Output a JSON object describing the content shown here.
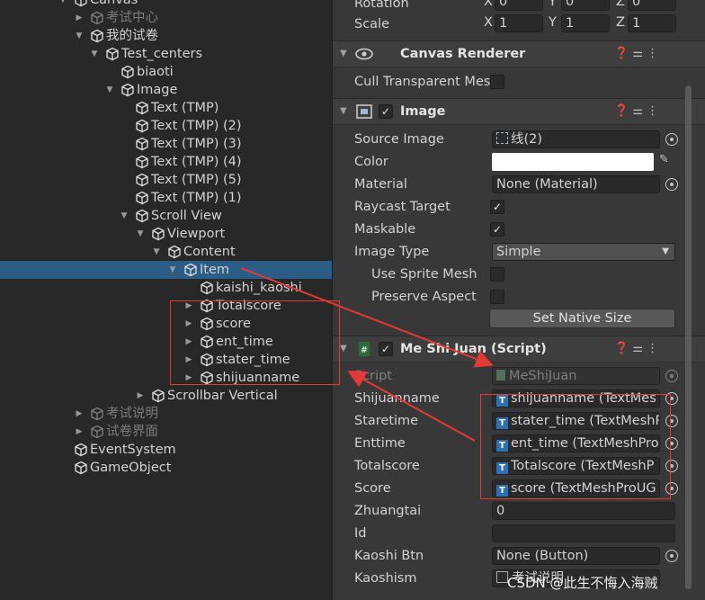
{
  "hierarchy": {
    "rows": [
      {
        "label": "Canvas",
        "dim": false,
        "sel": false
      },
      {
        "label": "考试中心",
        "dim": true,
        "sel": false
      },
      {
        "label": "我的试卷",
        "dim": false,
        "sel": false
      },
      {
        "label": "Test_centers",
        "dim": false,
        "sel": false
      },
      {
        "label": "biaoti",
        "dim": false,
        "sel": false
      },
      {
        "label": "Image",
        "dim": false,
        "sel": false
      },
      {
        "label": "Text (TMP)",
        "dim": false,
        "sel": false
      },
      {
        "label": "Text (TMP) (2)",
        "dim": false,
        "sel": false
      },
      {
        "label": "Text (TMP) (3)",
        "dim": false,
        "sel": false
      },
      {
        "label": "Text (TMP) (4)",
        "dim": false,
        "sel": false
      },
      {
        "label": "Text (TMP) (5)",
        "dim": false,
        "sel": false
      },
      {
        "label": "Text (TMP) (1)",
        "dim": false,
        "sel": false
      },
      {
        "label": "Scroll View",
        "dim": false,
        "sel": false
      },
      {
        "label": "Viewport",
        "dim": false,
        "sel": false
      },
      {
        "label": "Content",
        "dim": false,
        "sel": false
      },
      {
        "label": "Item",
        "dim": false,
        "sel": true
      },
      {
        "label": "kaishi_kaoshi",
        "dim": false,
        "sel": false
      },
      {
        "label": "Totalscore",
        "dim": false,
        "sel": false
      },
      {
        "label": "score",
        "dim": false,
        "sel": false
      },
      {
        "label": "ent_time",
        "dim": false,
        "sel": false
      },
      {
        "label": "stater_time",
        "dim": false,
        "sel": false
      },
      {
        "label": "shijuanname",
        "dim": false,
        "sel": false
      },
      {
        "label": "Scrollbar Vertical",
        "dim": false,
        "sel": false
      },
      {
        "label": "考试说明",
        "dim": true,
        "sel": false
      },
      {
        "label": "试卷界面",
        "dim": true,
        "sel": false
      },
      {
        "label": "EventSystem",
        "dim": false,
        "sel": false
      },
      {
        "label": "GameObject",
        "dim": false,
        "sel": false
      }
    ]
  },
  "inspector": {
    "transform": {
      "rotation_label": "Rotation",
      "scale_label": "Scale",
      "axis_x": "X",
      "axis_y": "Y",
      "axis_z": "Z",
      "rotation_values": [
        "0",
        "0",
        "0"
      ],
      "scale_values": [
        "1",
        "1",
        "1"
      ]
    },
    "canvas_renderer": {
      "title": "Canvas Renderer",
      "cull_label": "Cull Transparent Mes"
    },
    "image": {
      "title": "Image",
      "source_image_label": "Source Image",
      "source_image_value": "线(2)",
      "color_label": "Color",
      "color_value": "#ffffff",
      "material_label": "Material",
      "material_value": "None (Material)",
      "raycast_label": "Raycast Target",
      "maskable_label": "Maskable",
      "image_type_label": "Image Type",
      "image_type_value": "Simple",
      "use_sprite_mesh_label": "Use Sprite Mesh",
      "preserve_aspect_label": "Preserve Aspect",
      "set_native_size_label": "Set Native Size"
    },
    "script": {
      "title": "Me Shi Juan (Script)",
      "script_label": "Script",
      "script_value": "MeShiJuan",
      "fields": [
        {
          "label": "Shijuanname",
          "value": "shijuanname (TextMes"
        },
        {
          "label": "Staretime",
          "value": "stater_time (TextMeshP"
        },
        {
          "label": "Enttime",
          "value": "ent_time (TextMeshPro"
        },
        {
          "label": "Totalscore",
          "value": "Totalscore (TextMeshP"
        },
        {
          "label": "Score",
          "value": "score (TextMeshProUG"
        }
      ],
      "zhuangtai_label": "Zhuangtai",
      "zhuangtai_value": "0",
      "id_label": "Id",
      "id_value": "",
      "kaoshi_btn_label": "Kaoshi Btn",
      "kaoshi_btn_value": "None (Button)",
      "kaoshism_label": "Kaoshism",
      "kaoshism_value": "考试说明"
    }
  },
  "watermark": "CSDN @此生不悔入海贼",
  "colors": {
    "selection": "#2c5d87",
    "annotation": "#e53935",
    "tmp_icon": "#2f6fb4"
  }
}
